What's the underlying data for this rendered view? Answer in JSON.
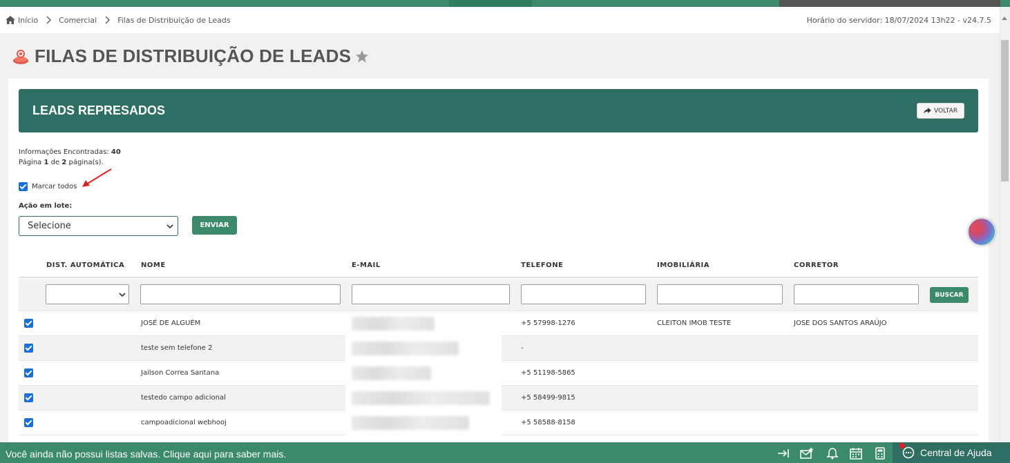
{
  "breadcrumb": {
    "items": [
      "Início",
      "Comercial",
      "Filas de Distribuição de Leads"
    ],
    "server_time": "Horário do servidor: 18/07/2024 13h22 - v24.7.5"
  },
  "page": {
    "title": "FILAS DE DISTRIBUIÇÃO DE LEADS"
  },
  "section": {
    "title": "LEADS REPRESADOS",
    "back_label": "VOLTAR"
  },
  "info": {
    "found_label": "Informações Encontradas:",
    "found_count": "40",
    "page_word": "Página",
    "page_current": "1",
    "of_word": "de",
    "page_total": "2",
    "pages_suffix": "página(s)."
  },
  "mark_all_label": "Marcar todos",
  "batch": {
    "label": "Ação em lote:",
    "selected": "Selecione",
    "send_label": "ENVIAR"
  },
  "table": {
    "headers": [
      "DIST. AUTOMÁTICA",
      "NOME",
      "E-MAIL",
      "TELEFONE",
      "IMOBILIÁRIA",
      "CORRETOR"
    ],
    "search_label": "BUSCAR",
    "rows": [
      {
        "checked": true,
        "name": "JOSÉ DE ALGUÉM",
        "phone": "+5 57998-1276",
        "agency": "CLEITON IMOB TESTE",
        "broker": "JOSE DOS SANTOS ARAÚJO"
      },
      {
        "checked": true,
        "name": "teste sem telefone 2",
        "phone": "-",
        "agency": "",
        "broker": ""
      },
      {
        "checked": true,
        "name": "Jailson Correa Santana",
        "phone": "+5 51198-5865",
        "agency": "",
        "broker": ""
      },
      {
        "checked": true,
        "name": "testedo campo adicional",
        "phone": "+5 58499-9815",
        "agency": "",
        "broker": ""
      },
      {
        "checked": true,
        "name": "campoadicional webhooj",
        "phone": "+5 58588-8158",
        "agency": "",
        "broker": ""
      }
    ]
  },
  "bottombar": {
    "message": "Você ainda não possui listas salvas. Clique aqui para saber mais.",
    "help_label": "Central de Ajuda"
  },
  "colors": {
    "brand_green": "#3b8a6c",
    "header_green": "#2e6e63",
    "checkbox_blue": "#1a6fd6"
  }
}
